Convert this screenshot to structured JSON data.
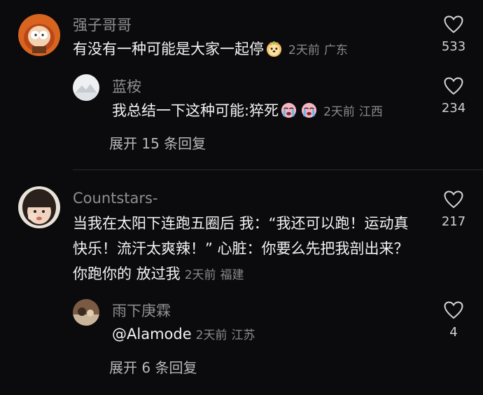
{
  "comments": [
    {
      "username": "强子哥哥",
      "text": "有没有一种可能是大家一起停",
      "time": "2天前",
      "location": "广东",
      "likes": "533",
      "avatar_icon": "cartoon-character-avatar",
      "reply": {
        "username": "蓝桉",
        "text": "我总结一下这种可能:猝死",
        "time": "2天前",
        "location": "江西",
        "likes": "234",
        "avatar_icon": "landscape-avatar"
      },
      "expand_label": "展开 15 条回复"
    },
    {
      "username": "Countstars-",
      "text": "当我在太阳下连跑五圈后 我：“我还可以跑！运动真快乐！流汗太爽辣！” 心脏：你要么先把我剖出来？你跑你的 放过我",
      "time": "2天前",
      "location": "福建",
      "likes": "217",
      "avatar_icon": "child-photo-avatar",
      "reply": {
        "username": "雨下庚霖",
        "text": "@Alamode",
        "time": "2天前",
        "location": "江苏",
        "likes": "4",
        "avatar_icon": "photo-avatar"
      },
      "expand_label": "展开 6 条回复"
    }
  ],
  "colors": {
    "background": "#0b0b0d",
    "username": "#8e8e93",
    "text": "#f2f2f2",
    "meta": "#8a8a8e"
  }
}
